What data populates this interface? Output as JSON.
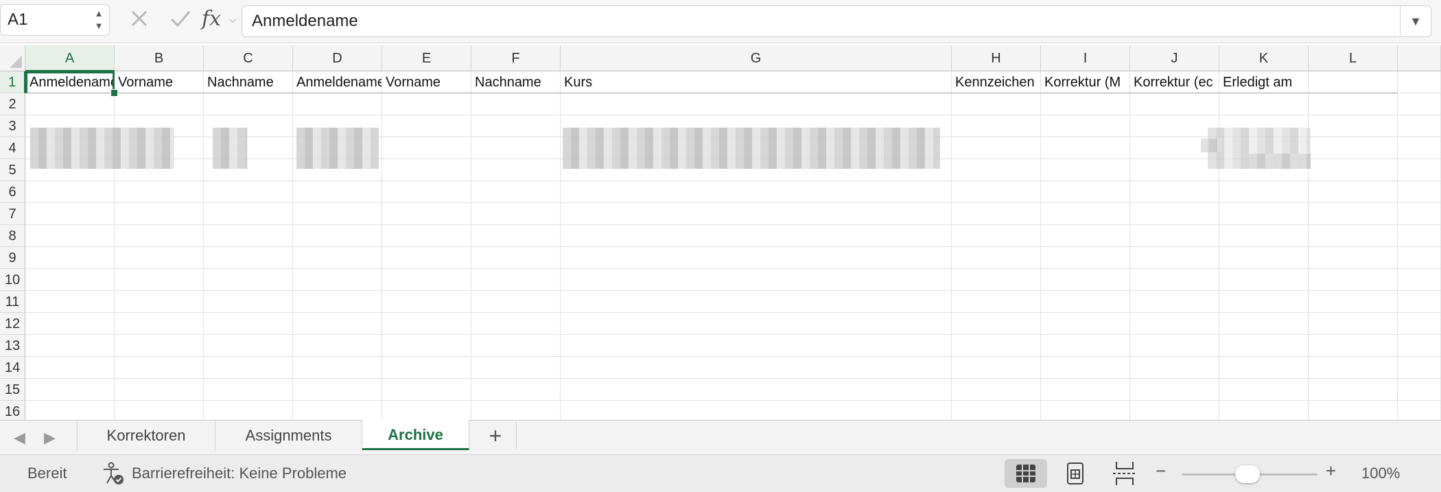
{
  "formula_bar": {
    "name_box": "A1",
    "formula": "Anmeldename",
    "cancel_icon": "close-icon",
    "confirm_icon": "check-icon",
    "function_label": "fx"
  },
  "grid": {
    "columns": [
      "A",
      "B",
      "C",
      "D",
      "E",
      "F",
      "G",
      "H",
      "I",
      "J",
      "K",
      "L"
    ],
    "rows": [
      "1",
      "2",
      "3",
      "4",
      "5",
      "6",
      "7",
      "8",
      "9",
      "10",
      "11",
      "12",
      "13",
      "14",
      "15",
      "16"
    ],
    "header_row": [
      "Anmeldename",
      "Vorname",
      "Nachname",
      "Anmeldename",
      "Vorname",
      "Nachname",
      "Kurs",
      "Kennzeichen",
      "Korrektur (M",
      "Korrektur (ec",
      "Erledigt am",
      ""
    ],
    "active_cell": "A1"
  },
  "sheet_tabs": {
    "tabs": [
      "Korrektoren",
      "Assignments",
      "Archive"
    ],
    "active": "Archive",
    "add_label": "+"
  },
  "status_bar": {
    "ready": "Bereit",
    "accessibility": "Barrierefreiheit: Keine Probleme",
    "zoom": "100%",
    "zoom_minus": "−",
    "zoom_plus": "+",
    "zoom_level_percent": 100
  },
  "colors": {
    "accent": "#1e7145"
  }
}
